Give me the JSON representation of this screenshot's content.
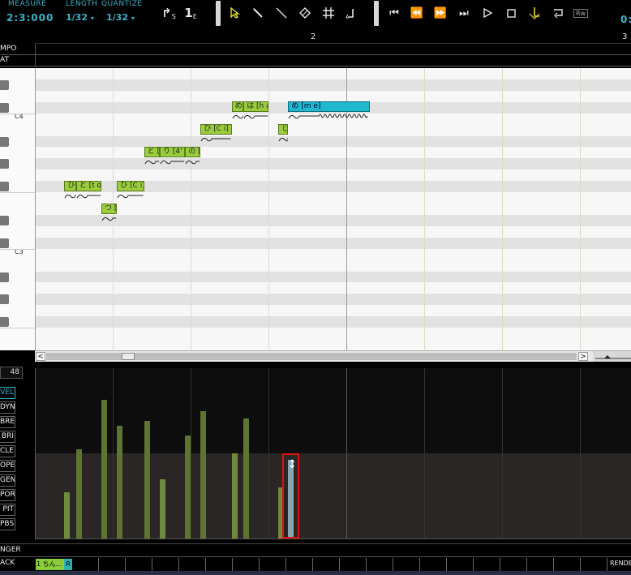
{
  "toolbar": {
    "measure_label": "MEASURE",
    "measure_value": "2:3:000",
    "length_label": "LENGTH",
    "length_value": "1/32",
    "quantize_label": "QUANTIZE",
    "quantize_value": "1/32",
    "start_marker": "S",
    "end_marker": "E",
    "tools": [
      "pointer-icon",
      "pencil-icon",
      "line-icon",
      "eraser-icon",
      "grid-icon",
      "vibrato-icon"
    ],
    "transport": [
      "go-start-icon",
      "rewind-icon",
      "fast-forward-icon",
      "go-end-icon",
      "play-icon",
      "stop-icon",
      "record-icon",
      "loop-icon",
      "rewire-icon"
    ],
    "rewire_text": "Rw",
    "time_readout": "0:"
  },
  "ruler": {
    "measures": [
      "2",
      "3"
    ]
  },
  "rows": {
    "tempo": "MPO",
    "beat": "AT",
    "singer": "NGER",
    "track": "ACK"
  },
  "piano": {
    "c4": "C4",
    "c3": "C3"
  },
  "notes": [
    {
      "lyric": "ひ ...",
      "lane": 14,
      "start": 0.3,
      "len": 0.3,
      "selected": false
    },
    {
      "lyric": "と [t o]",
      "lane": 14,
      "start": 0.6,
      "len": 0.65,
      "selected": false
    },
    {
      "lyric": "つ [ts...",
      "lane": 16,
      "start": 1.25,
      "len": 0.4,
      "selected": false
    },
    {
      "lyric": "ひ [C i]",
      "lane": 14,
      "start": 1.65,
      "len": 0.7,
      "selected": false
    },
    {
      "lyric": "と [t ...",
      "lane": 11,
      "start": 2.35,
      "len": 0.4,
      "selected": false
    },
    {
      "lyric": "り [4' i]",
      "lane": 11,
      "start": 2.75,
      "len": 0.65,
      "selected": false
    },
    {
      "lyric": "の [n...",
      "lane": 11,
      "start": 3.4,
      "len": 0.4,
      "selected": false
    },
    {
      "lyric": "ひ [C i]",
      "lane": 9,
      "start": 3.8,
      "len": 0.8,
      "selected": false
    },
    {
      "lyric": "め ...",
      "lane": 7,
      "start": 4.6,
      "len": 0.3,
      "selected": false
    },
    {
      "lyric": "は [h a]",
      "lane": 7,
      "start": 4.9,
      "len": 0.65,
      "selected": false
    },
    {
      "lyric": "じ...",
      "lane": 9,
      "start": 5.8,
      "len": 0.25,
      "selected": false
    },
    {
      "lyric": "め [m e]",
      "lane": 7,
      "start": 6.05,
      "len": 2.1,
      "selected": true
    }
  ],
  "control": {
    "value": "48",
    "params": [
      "VEL",
      "DYN",
      "BRE",
      "BRI",
      "CLE",
      "OPE",
      "GEN",
      "POR",
      "PIT",
      "PBS"
    ],
    "active_param": "VEL",
    "velocities": [
      {
        "start": 0.3,
        "value": 54
      },
      {
        "start": 0.6,
        "value": 105
      },
      {
        "start": 1.25,
        "value": 163
      },
      {
        "start": 1.65,
        "value": 132
      },
      {
        "start": 2.35,
        "value": 138
      },
      {
        "start": 2.75,
        "value": 70
      },
      {
        "start": 3.4,
        "value": 121
      },
      {
        "start": 3.8,
        "value": 150
      },
      {
        "start": 4.6,
        "value": 100
      },
      {
        "start": 4.9,
        "value": 141
      },
      {
        "start": 5.8,
        "value": 60
      },
      {
        "start": 6.05,
        "value": 92
      }
    ],
    "selected_index": 11,
    "drag_cursor": "↕"
  },
  "track": {
    "name": "1 ちん...",
    "r": "R",
    "render": "RENDE"
  }
}
